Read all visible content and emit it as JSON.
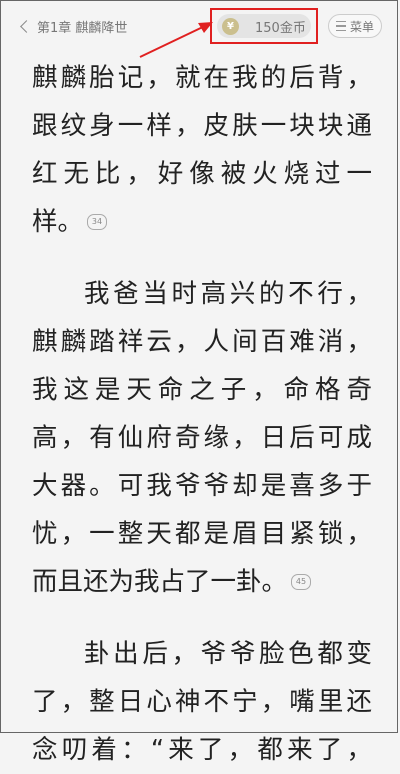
{
  "header": {
    "back_label": "第1章 麒麟降世",
    "coins_label": "150金币",
    "coin_icon_glyph": "¥",
    "menu_label": "菜单",
    "highlight_color": "#e02020"
  },
  "paragraphs": [
    {
      "lines": [
        "麒麟胎记，就在我的后背，",
        "跟纹身一样，皮肤一块块通",
        "红无比，好像被火烧过一",
        "样。"
      ],
      "comment_count": "34"
    },
    {
      "lines": [
        "我爸当时高兴的不行，",
        "麒麟踏祥云，人间百难消，",
        "我这是天命之子，命格奇",
        "高，有仙府奇缘，日后可成",
        "大器。可我爷爷却是喜多于",
        "忧，一整天都是眉目紧锁，",
        "而且还为我占了一卦。"
      ],
      "comment_count": "45"
    },
    {
      "lines": [
        "卦出后，爷爷脸色都变",
        "了，整日心神不宁，嘴里还",
        "念叨着：“来了，都来了，"
      ],
      "comment_count": ""
    }
  ]
}
